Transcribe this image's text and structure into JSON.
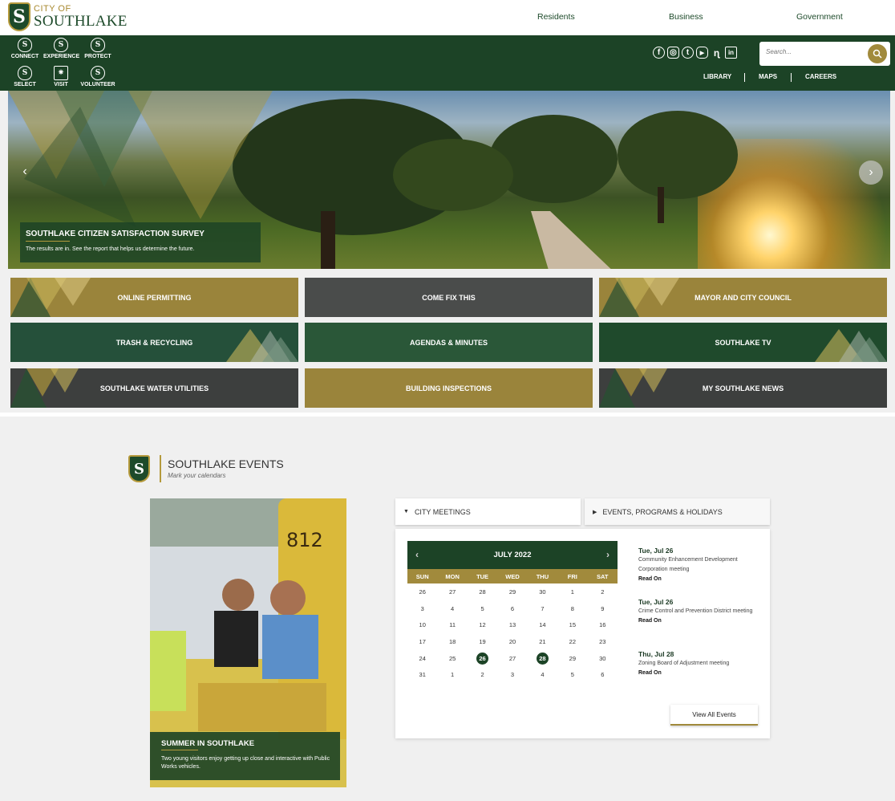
{
  "header": {
    "logo": {
      "line1": "CITY OF",
      "line2": "SOUTHLAKE",
      "badge_letter": "S"
    },
    "nav": [
      "Residents",
      "Business",
      "Government"
    ]
  },
  "quicklinks": [
    {
      "label": "CONNECT",
      "icon": "s-badge-icon"
    },
    {
      "label": "EXPERIENCE",
      "icon": "s-badge-icon"
    },
    {
      "label": "PROTECT",
      "icon": "s-badge-icon"
    },
    {
      "label": "SELECT",
      "icon": "s-badge-icon"
    },
    {
      "label": "VISIT",
      "icon": "star-badge-icon"
    },
    {
      "label": "VOLUNTEER",
      "icon": "s-circle-icon"
    }
  ],
  "social": [
    "facebook-icon",
    "instagram-icon",
    "twitter-icon",
    "youtube-icon",
    "nextdoor-icon",
    "linkedin-icon"
  ],
  "search": {
    "placeholder": "Search..."
  },
  "utility": [
    "LIBRARY",
    "MAPS",
    "CAREERS"
  ],
  "hero": {
    "title": "SOUTHLAKE CITIZEN SATISFACTION SURVEY",
    "subtitle": "The results are in. See the report that helps us determine the future."
  },
  "tiles": [
    "ONLINE PERMITTING",
    "COME FIX THIS",
    "MAYOR AND CITY COUNCIL",
    "TRASH & RECYCLING",
    "AGENDAS & MINUTES",
    "SOUTHLAKE TV",
    "SOUTHLAKE WATER UTILITIES",
    "BUILDING INSPECTIONS",
    "MY SOUTHLAKE NEWS"
  ],
  "events": {
    "title": "SOUTHLAKE EVENTS",
    "subtitle": "Mark your calendars",
    "photo": {
      "caption_title": "SUMMER IN SOUTHLAKE",
      "caption_text": "Two young visitors enjoy getting up close and interactive with Public Works vehicles.",
      "vehicle_number": "812"
    },
    "tabs": [
      "CITY MEETINGS",
      "EVENTS, PROGRAMS & HOLIDAYS"
    ],
    "calendar": {
      "month": "JULY 2022",
      "dow": [
        "SUN",
        "MON",
        "TUE",
        "WED",
        "THU",
        "FRI",
        "SAT"
      ],
      "days": [
        "26",
        "27",
        "28",
        "29",
        "30",
        "1",
        "2",
        "3",
        "4",
        "5",
        "6",
        "7",
        "8",
        "9",
        "10",
        "11",
        "12",
        "13",
        "14",
        "15",
        "16",
        "17",
        "18",
        "19",
        "20",
        "21",
        "22",
        "23",
        "24",
        "25",
        "26",
        "27",
        "28",
        "29",
        "30",
        "31",
        "1",
        "2",
        "3",
        "4",
        "5",
        "6"
      ],
      "selected_indices": [
        30,
        32
      ]
    },
    "items": [
      {
        "date": "Tue, Jul 26",
        "name": "Community Enhancement Development Corporation meeting",
        "link": "Read On"
      },
      {
        "date": "Tue, Jul 26",
        "name": "Crime Control and Prevention District meeting",
        "link": "Read On"
      },
      {
        "date": "Thu, Jul 28",
        "name": "Zoning Board of Adjustment meeting",
        "link": "Read On"
      }
    ],
    "view_all": "View All Events"
  },
  "colors": {
    "green": "#1c4326",
    "gold": "#a18a3c",
    "gray_tile": "#3d3f3e"
  }
}
